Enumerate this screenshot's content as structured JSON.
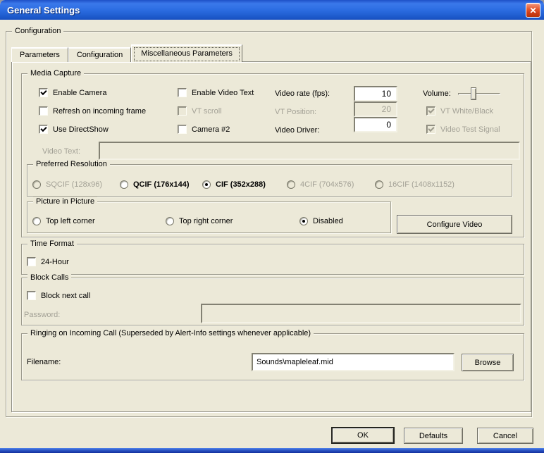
{
  "window": {
    "title": "General Settings",
    "close_icon": "✕"
  },
  "configuration_group_title": "Configuration",
  "tabs": {
    "parameters": "Parameters",
    "configuration": "Configuration",
    "miscellaneous": "Miscellaneous Parameters"
  },
  "media_capture": {
    "title": "Media Capture",
    "col1": [
      {
        "label": "Enable Camera",
        "checked": true,
        "disabled": false
      },
      {
        "label": "Refresh on incoming frame",
        "checked": false,
        "disabled": false
      },
      {
        "label": "Use DirectShow",
        "checked": true,
        "disabled": false
      }
    ],
    "col2": [
      {
        "label": "Enable Video Text",
        "checked": false,
        "disabled": false
      },
      {
        "label": "VT scroll",
        "checked": false,
        "disabled": true
      },
      {
        "label": "Camera #2",
        "checked": false,
        "disabled": false
      }
    ],
    "numeric_fields": [
      {
        "label": "Video rate (fps):",
        "value": "10",
        "disabled": false
      },
      {
        "label": "VT Position:",
        "value": "20",
        "disabled": true
      },
      {
        "label": "Video Driver:",
        "value": "0",
        "disabled": false
      }
    ],
    "volume_label": "Volume:",
    "col4": [
      {
        "label": "VT White/Black",
        "checked": true,
        "disabled": true
      },
      {
        "label": "Video Test Signal",
        "checked": true,
        "disabled": true
      }
    ],
    "video_text_label": "Video Text:",
    "video_text_value": ""
  },
  "preferred_resolution": {
    "title": "Preferred Resolution",
    "options": [
      {
        "label": "SQCIF (128x96)",
        "selected": false,
        "disabled": true
      },
      {
        "label": "QCIF (176x144)",
        "selected": false,
        "disabled": false
      },
      {
        "label": "CIF (352x288)",
        "selected": true,
        "disabled": false
      },
      {
        "label": "4CIF (704x576)",
        "selected": false,
        "disabled": true
      },
      {
        "label": "16CIF (1408x1152)",
        "selected": false,
        "disabled": true
      }
    ]
  },
  "picture_in_picture": {
    "title": "Picture in Picture",
    "options": [
      {
        "label": "Top left corner",
        "selected": false
      },
      {
        "label": "Top right corner",
        "selected": false
      },
      {
        "label": "Disabled",
        "selected": true
      }
    ]
  },
  "configure_video_button": "Configure Video",
  "time_format": {
    "title": "Time Format",
    "checkbox_label": "24-Hour",
    "checked": false
  },
  "block_calls": {
    "title": "Block Calls",
    "checkbox_label": "Block next call",
    "checked": false,
    "password_label": "Password:",
    "password_value": ""
  },
  "ringing": {
    "title": "Ringing on Incoming Call (Superseded by Alert-Info settings whenever applicable)",
    "filename_label": "Filename:",
    "filename_value": "Sounds\\mapleleaf.mid",
    "browse_label": "Browse"
  },
  "footer": {
    "ok_label": "OK",
    "defaults_label": "Defaults",
    "cancel_label": "Cancel"
  }
}
